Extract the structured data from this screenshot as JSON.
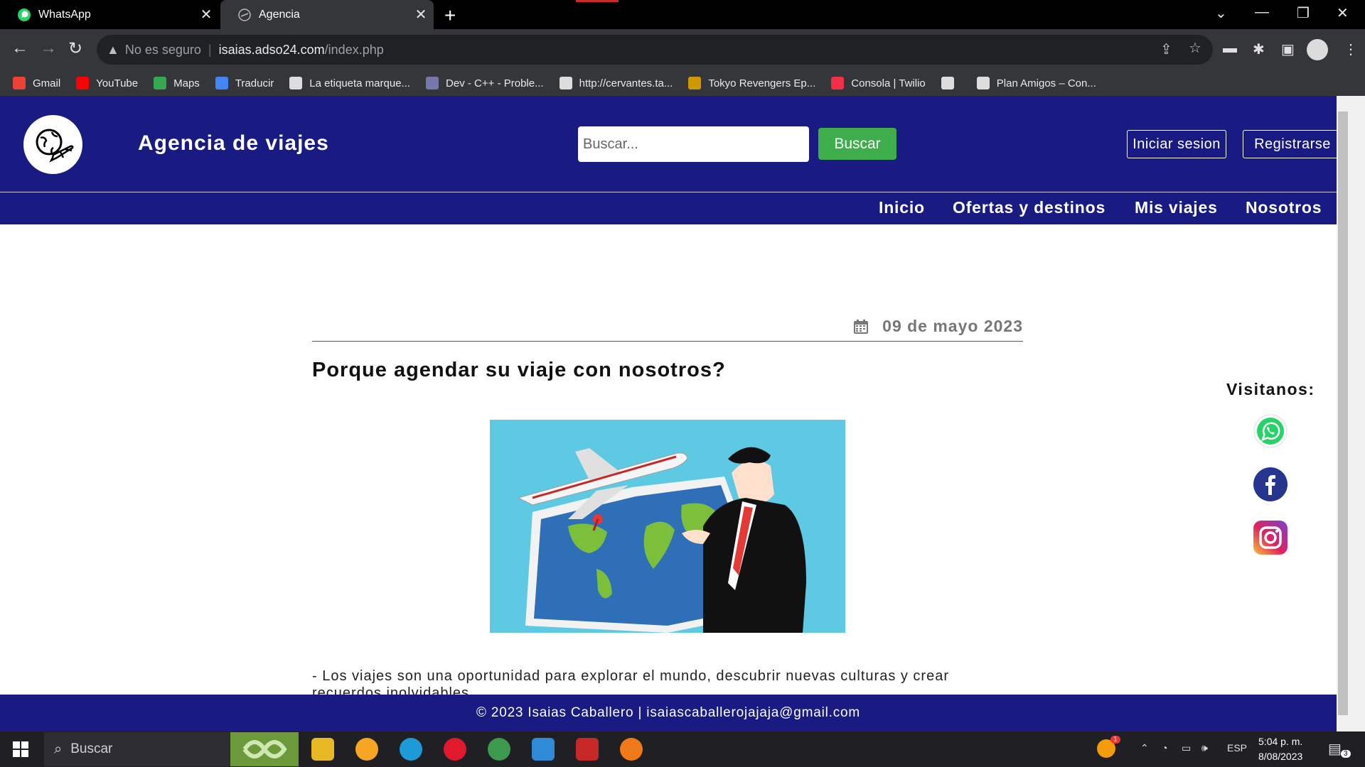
{
  "browser": {
    "tabs": [
      {
        "title": "WhatsApp",
        "icon": "whatsapp-icon"
      },
      {
        "title": "Agencia",
        "icon": "globe-plane-icon"
      }
    ],
    "address": {
      "security": "No es seguro",
      "host": "isaias.adso24.com",
      "path": "/index.php"
    },
    "bookmarks": [
      {
        "label": "Gmail",
        "color": "#ea4335"
      },
      {
        "label": "YouTube",
        "color": "#ff0000"
      },
      {
        "label": "Maps",
        "color": "#34a853"
      },
      {
        "label": "Traducir",
        "color": "#4285f4"
      },
      {
        "label": "La etiqueta marque...",
        "color": "#dddddd"
      },
      {
        "label": "Dev - C++ - Proble...",
        "color": "#7777aa"
      },
      {
        "label": "http://cervantes.ta...",
        "color": "#dddddd"
      },
      {
        "label": "Tokyo Revengers Ep...",
        "color": "#cc9900"
      },
      {
        "label": "Consola | Twilio",
        "color": "#f22f46"
      },
      {
        "label": "",
        "color": "#dddddd"
      },
      {
        "label": "Plan Amigos – Con...",
        "color": "#dddddd"
      }
    ]
  },
  "site": {
    "title": "Agencia de viajes",
    "search_placeholder": "Buscar...",
    "search_button": "Buscar",
    "login_button": "Iniciar sesion",
    "register_button": "Registrarse",
    "nav": [
      "Inicio",
      "Ofertas y destinos",
      "Mis viajes",
      "Nosotros"
    ],
    "colors": {
      "header": "#1a1a83",
      "search_button": "#3dae4b"
    }
  },
  "post": {
    "date": "09 de mayo 2023",
    "title": "Porque agendar su viaje con nosotros?",
    "text": "- Los viajes son una oportunidad para explorar el mundo, descubrir nuevas culturas y crear recuerdos inolvidables."
  },
  "sidebar": {
    "label": "Visitanos:",
    "socials": [
      "whatsapp-icon",
      "facebook-icon",
      "instagram-icon"
    ]
  },
  "footer": {
    "text": "© 2023 Isaias Caballero | isaiascaballerojajaja@gmail.com"
  },
  "taskbar": {
    "search": "Buscar",
    "language": "ESP",
    "time": "5:04 p. m.",
    "date": "8/08/2023",
    "notifications": "3",
    "badge": "1"
  }
}
